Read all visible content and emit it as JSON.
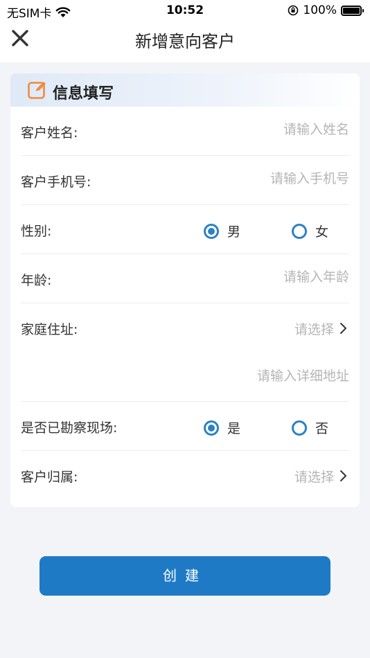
{
  "status_bar": {
    "carrier": "无SIM卡",
    "time": "10:52",
    "battery": "100%"
  },
  "nav": {
    "title": "新增意向客户",
    "close_icon": "close-icon"
  },
  "section": {
    "title": "信息填写",
    "icon": "edit-icon",
    "accent": "#f08a3c"
  },
  "form": {
    "name_label": "客户姓名:",
    "name_placeholder": "请输入姓名",
    "phone_label": "客户手机号:",
    "phone_placeholder": "请输入手机号",
    "gender_label": "性别:",
    "gender_options": [
      "男",
      "女"
    ],
    "gender_selected": "男",
    "age_label": "年龄:",
    "age_placeholder": "请输入年龄",
    "address_label": "家庭住址:",
    "address_select": "请选择",
    "address_detail_placeholder": "请输入详细地址",
    "survey_label": "是否已勘察现场:",
    "survey_options": [
      "是",
      "否"
    ],
    "survey_selected": "是",
    "owner_label": "客户归属:",
    "owner_select": "请选择"
  },
  "actions": {
    "create_label": "创建"
  },
  "colors": {
    "primary": "#1f7ac6",
    "radio": "#2a82c5",
    "placeholder": "#b5b5b5"
  }
}
